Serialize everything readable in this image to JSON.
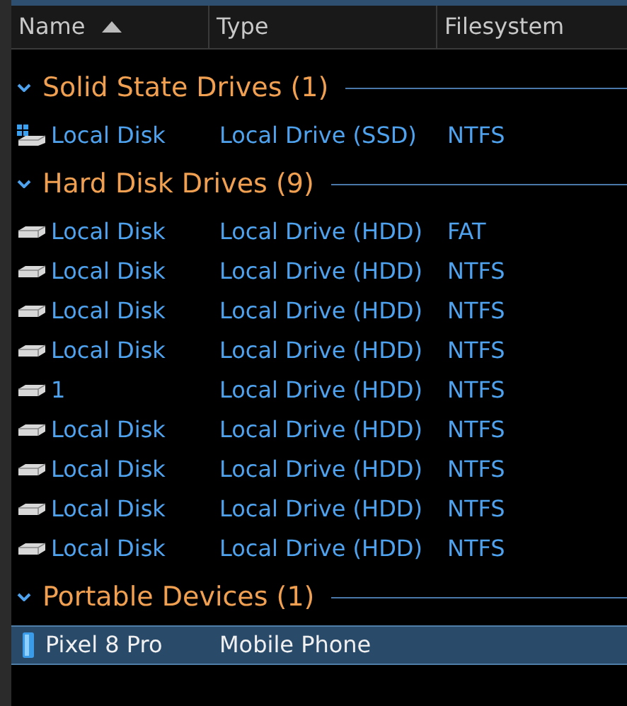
{
  "columns": [
    {
      "label": "Name",
      "sorted": true
    },
    {
      "label": "Type",
      "sorted": false
    },
    {
      "label": "Filesystem",
      "sorted": false
    }
  ],
  "groups": [
    {
      "title": "Solid State Drives (1)",
      "expanded": true,
      "items": [
        {
          "kind": "ssd",
          "name": "Local Disk",
          "type": "Local Drive (SSD)",
          "filesystem": "NTFS",
          "selected": false
        }
      ]
    },
    {
      "title": "Hard Disk Drives (9)",
      "expanded": true,
      "items": [
        {
          "kind": "hdd",
          "name": "Local Disk",
          "type": "Local Drive (HDD)",
          "filesystem": "FAT",
          "selected": false
        },
        {
          "kind": "hdd",
          "name": "Local Disk",
          "type": "Local Drive (HDD)",
          "filesystem": "NTFS",
          "selected": false
        },
        {
          "kind": "hdd",
          "name": "Local Disk",
          "type": "Local Drive (HDD)",
          "filesystem": "NTFS",
          "selected": false
        },
        {
          "kind": "hdd",
          "name": "Local Disk",
          "type": "Local Drive (HDD)",
          "filesystem": "NTFS",
          "selected": false
        },
        {
          "kind": "hdd",
          "name": "1",
          "type": "Local Drive (HDD)",
          "filesystem": "NTFS",
          "selected": false
        },
        {
          "kind": "hdd",
          "name": "Local Disk",
          "type": "Local Drive (HDD)",
          "filesystem": "NTFS",
          "selected": false
        },
        {
          "kind": "hdd",
          "name": "Local Disk",
          "type": "Local Drive (HDD)",
          "filesystem": "NTFS",
          "selected": false
        },
        {
          "kind": "hdd",
          "name": "Local Disk",
          "type": "Local Drive (HDD)",
          "filesystem": "NTFS",
          "selected": false
        },
        {
          "kind": "hdd",
          "name": "Local Disk",
          "type": "Local Drive (HDD)",
          "filesystem": "NTFS",
          "selected": false
        }
      ]
    },
    {
      "title": "Portable Devices (1)",
      "expanded": true,
      "items": [
        {
          "kind": "phone",
          "name": "Pixel 8 Pro",
          "type": "Mobile Phone",
          "selected": true
        }
      ]
    }
  ]
}
